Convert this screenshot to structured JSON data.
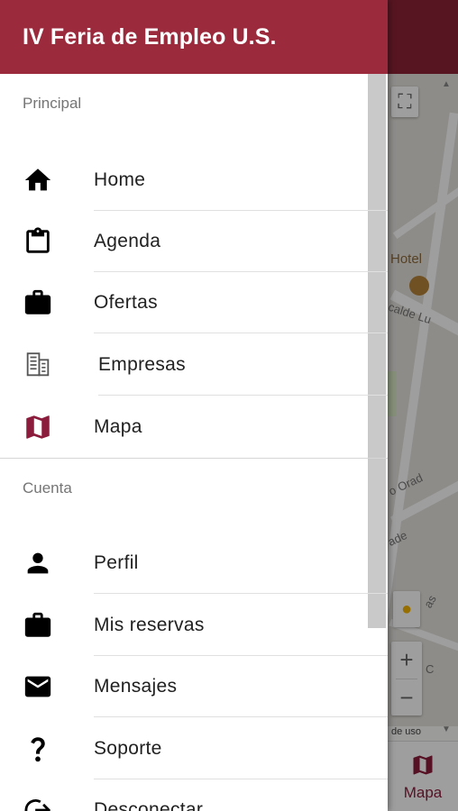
{
  "app": {
    "title": "IV Feria de Empleo U.S."
  },
  "colors": {
    "header": "#9a2a3c",
    "accent": "#8c1c3c"
  },
  "drawer": {
    "sections": [
      {
        "label": "Principal",
        "items": [
          {
            "label": "Home",
            "icon": "home-icon"
          },
          {
            "label": "Agenda",
            "icon": "clipboard-icon"
          },
          {
            "label": "Ofertas",
            "icon": "briefcase-icon"
          },
          {
            "label": "Empresas",
            "icon": "building-icon"
          },
          {
            "label": "Mapa",
            "icon": "map-icon"
          }
        ]
      },
      {
        "label": "Cuenta",
        "items": [
          {
            "label": "Perfil",
            "icon": "person-icon"
          },
          {
            "label": "Mis reservas",
            "icon": "briefcase-icon"
          },
          {
            "label": "Mensajes",
            "icon": "mail-icon"
          },
          {
            "label": "Soporte",
            "icon": "question-icon"
          },
          {
            "label": "Desconectar",
            "icon": "logout-icon"
          }
        ]
      }
    ]
  },
  "map": {
    "labels": {
      "hotel": "Hotel",
      "street1": "calde Lu",
      "street2": "o Orad",
      "street3": "ade",
      "street4": "as",
      "street5": "C"
    },
    "zoom_in": "+",
    "zoom_out": "−",
    "terms": "de uso"
  },
  "bottom_nav": {
    "active_tab": "Mapa"
  }
}
